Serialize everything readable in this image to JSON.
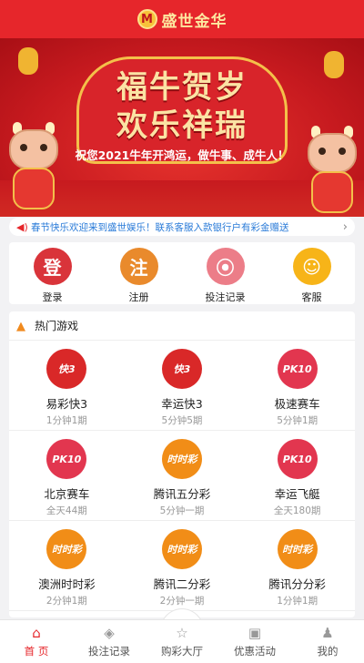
{
  "header": {
    "logo_glyph": "M",
    "brand": "盛世金华"
  },
  "banner": {
    "title_line1": "福牛贺岁",
    "title_line2": "欢乐祥瑞",
    "subtitle": "祝您2021牛年开鸿运，做牛事、成牛人！"
  },
  "notice": {
    "icon": "speaker-icon",
    "text": "春节快乐欢迎来到盛世娱乐！联系客服入款银行户有彩金赠送",
    "arrow": "›"
  },
  "quick": [
    {
      "label": "登录",
      "glyph": "登",
      "color": "#d9343a"
    },
    {
      "label": "注册",
      "glyph": "注",
      "color": "#e98a2c"
    },
    {
      "label": "投注记录",
      "glyph": "⦿",
      "color": "#ec7d88"
    },
    {
      "label": "客服",
      "glyph": "☺",
      "color": "#f7b418"
    }
  ],
  "hot": {
    "title": "热门游戏",
    "games": [
      {
        "name": "易彩快3",
        "freq": "1分钟1期",
        "logo": "快3",
        "color": "#d92828"
      },
      {
        "name": "幸运快3",
        "freq": "5分钟5期",
        "logo": "快3",
        "color": "#d92828"
      },
      {
        "name": "极速赛车",
        "freq": "5分钟1期",
        "logo": "PK10",
        "color": "#e2364f"
      },
      {
        "name": "北京赛车",
        "freq": "全天44期",
        "logo": "PK10",
        "color": "#e2364f"
      },
      {
        "name": "腾讯五分彩",
        "freq": "5分钟一期",
        "logo": "时时彩",
        "color": "#f18d17"
      },
      {
        "name": "幸运飞艇",
        "freq": "全天180期",
        "logo": "PK10",
        "color": "#e2364f"
      },
      {
        "name": "澳洲时时彩",
        "freq": "2分钟1期",
        "logo": "时时彩",
        "color": "#f18d17"
      },
      {
        "name": "腾讯二分彩",
        "freq": "2分钟一期",
        "logo": "时时彩",
        "color": "#f18d17"
      },
      {
        "name": "腾讯分分彩",
        "freq": "1分钟1期",
        "logo": "时时彩",
        "color": "#f18d17"
      }
    ]
  },
  "tabs": [
    {
      "label": "首 页",
      "icon": "⌂"
    },
    {
      "label": "投注记录",
      "icon": "◈"
    },
    {
      "label": "购彩大厅",
      "icon": "☆"
    },
    {
      "label": "优惠活动",
      "icon": "▣"
    },
    {
      "label": "我的",
      "icon": "♟"
    }
  ],
  "colors": {
    "accent": "#e6262b",
    "link": "#2a7bd8"
  }
}
